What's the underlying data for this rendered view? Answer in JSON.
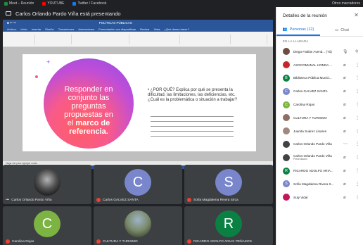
{
  "browser": {
    "tabs": [
      {
        "label": "Meet – Reunión",
        "color": "#1e8e3e"
      },
      {
        "label": "YOUTUBE",
        "color": "#ff0000"
      },
      {
        "label": "Twitter / Facebook",
        "color": "#1877f2"
      }
    ],
    "right_label": "Otros marcadores"
  },
  "meeting": {
    "presenting_label": "Carlos Orlando Pardo Viña está presentando"
  },
  "slide": {
    "title_line1": "Responder en",
    "title_line2": "conjunto las",
    "title_line3": "preguntas",
    "title_line4": "propuestas en",
    "title_line5_prefix": "el ",
    "title_line5_bold": "marco de",
    "title_line6": "referencia.",
    "question": "¿POR QUÉ? Explica por qué se presenta la dificultad, las limitaciones, las deficiencias, etc. ¿Cuál es la problemática o situación a trabajar?"
  },
  "powerpoint": {
    "menu": [
      "Archivo",
      "Inicio",
      "Insertar",
      "Diseño",
      "Transiciones",
      "Animaciones",
      "Presentación con diapositivas",
      "Revisar",
      "Vista",
      "¿Qué desea hacer?"
    ],
    "title_file": "POLÍTICAS PÚBLICAS",
    "notes_label": "Haga clic para agregar notas",
    "status_label": "Diapositiva 11 de 41   Español (Colombia)"
  },
  "tiles": [
    {
      "name": "Carlos Orlando Pardo Viña",
      "initial": "",
      "color": "",
      "kind": "photo",
      "muted": false
    },
    {
      "name": "Carlos GALVEZ SANTA",
      "initial": "C",
      "color": "#7986cb",
      "kind": "letter",
      "muted": true
    },
    {
      "name": "Sofía Magdalena Rivera Sirca",
      "initial": "S",
      "color": "#7986cb",
      "kind": "letter",
      "muted": true
    },
    {
      "name": "Carolina Rojas",
      "initial": "C",
      "color": "#7cb342",
      "kind": "letter",
      "muted": true
    },
    {
      "name": "CULTURA Y TURISMO",
      "initial": "",
      "color": "",
      "kind": "landscape",
      "muted": true
    },
    {
      "name": "RICARDO ADOLFO ARIAS PEÑASOS",
      "initial": "R",
      "color": "#0b8043",
      "kind": "letter",
      "muted": true
    }
  ],
  "panel": {
    "title": "Detalles de la reunión",
    "tab_people": "Personas (12)",
    "tab_chat": "Chat",
    "section": "EN LA LLAMADA",
    "participants": [
      {
        "name": "Diego Fabián Avend...",
        "sub": "",
        "initial": "",
        "color": "#6d4c41",
        "tag": "(Tú)"
      },
      {
        "name": "ASOCOMUNAL HONDA ...",
        "sub": "",
        "initial": "",
        "color": "#c62828",
        "tag": ""
      },
      {
        "name": "Biblioteca Pública Munici...",
        "sub": "",
        "initial": "B",
        "color": "#0b8043",
        "tag": ""
      },
      {
        "name": "Carlos GALVEZ SANTA",
        "sub": "",
        "initial": "C",
        "color": "#7986cb",
        "tag": ""
      },
      {
        "name": "Carolina Rojas",
        "sub": "",
        "initial": "C",
        "color": "#7cb342",
        "tag": ""
      },
      {
        "name": "CULTURA Y TURISMO",
        "sub": "",
        "initial": "",
        "color": "#8d6e63",
        "tag": ""
      },
      {
        "name": "Juanita Suárez Linares",
        "sub": "",
        "initial": "",
        "color": "#a1887f",
        "tag": ""
      },
      {
        "name": "Carlos Orlando Pardo Viña",
        "sub": "",
        "initial": "",
        "color": "#424242",
        "tag": ""
      },
      {
        "name": "Carlos Orlando Pardo Viña",
        "sub": "Presentación",
        "initial": "",
        "color": "#424242",
        "tag": ""
      },
      {
        "name": "RICARDO ADOLFO ARIA...",
        "sub": "",
        "initial": "R",
        "color": "#0b8043",
        "tag": ""
      },
      {
        "name": "Sofía Magdalena Rivera S...",
        "sub": "",
        "initial": "S",
        "color": "#7986cb",
        "tag": ""
      },
      {
        "name": "Suly Vidal",
        "sub": "",
        "initial": "",
        "color": "#c2185b",
        "tag": ""
      }
    ]
  }
}
